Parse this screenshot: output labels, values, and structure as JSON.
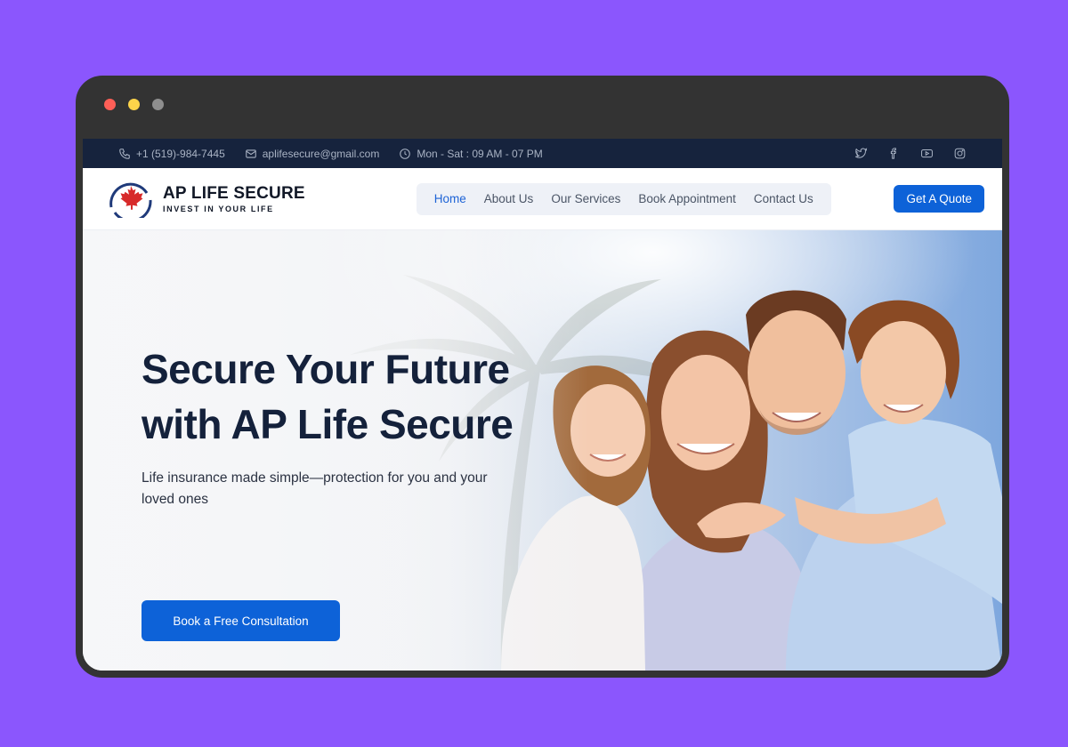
{
  "window": {
    "controls": [
      "close",
      "minimize",
      "maximize"
    ]
  },
  "topbar": {
    "phone": "+1 (519)-984-7445",
    "email": "aplifesecure@gmail.com",
    "hours": "Mon - Sat : 09 AM - 07 PM",
    "socials": [
      "twitter-icon",
      "facebook-icon",
      "youtube-icon",
      "instagram-icon"
    ]
  },
  "brand": {
    "name": "AP LIFE SECURE",
    "tagline": "INVEST IN YOUR LIFE"
  },
  "nav": {
    "items": [
      {
        "label": "Home",
        "active": true
      },
      {
        "label": "About Us"
      },
      {
        "label": "Our Services"
      },
      {
        "label": "Book Appointment"
      },
      {
        "label": "Contact Us"
      }
    ],
    "cta": "Get A Quote"
  },
  "hero": {
    "title": "Secure Your Future with AP Life Secure",
    "subtitle": "Life insurance made simple—protection for you and your loved ones",
    "cta": "Book a Free Consultation"
  },
  "colors": {
    "accent": "#0d62d8",
    "topbar": "#16233d",
    "heading": "#14213b",
    "backdrop": "#8b56fd"
  }
}
